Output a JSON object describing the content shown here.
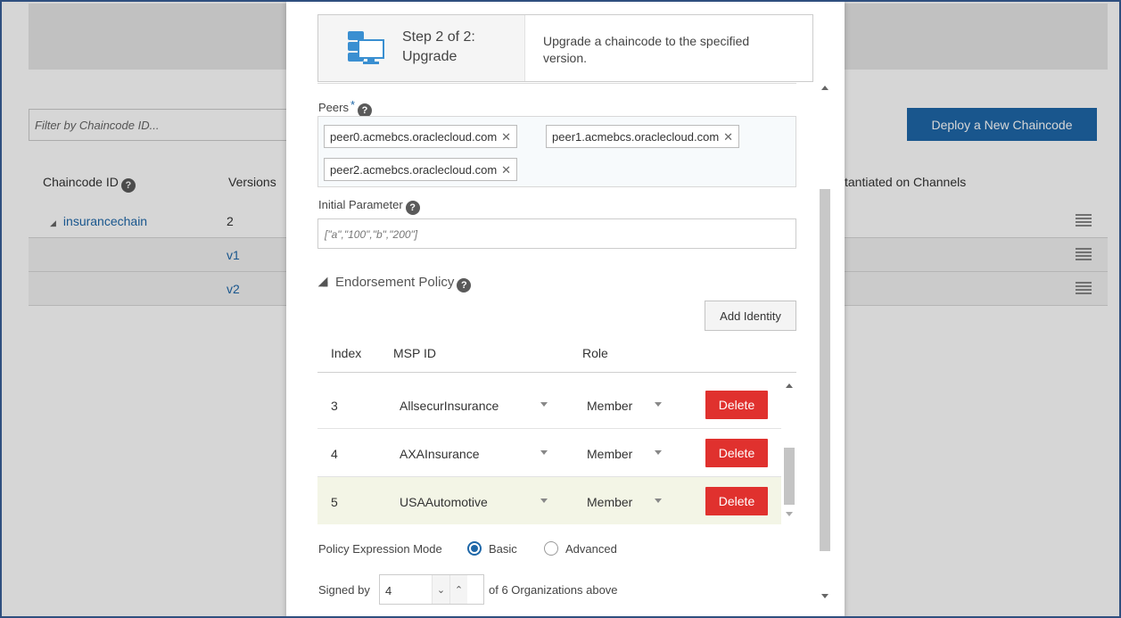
{
  "background": {
    "filter_placeholder": "Filter by Chaincode ID...",
    "deploy_button": "Deploy a New Chaincode",
    "columns": {
      "chaincode_id": "Chaincode ID",
      "versions": "Versions",
      "instantiated": "tantiated on Channels"
    },
    "rows": [
      {
        "chaincode": "insurancechain",
        "version": "2"
      },
      {
        "chaincode": "",
        "version": "v1"
      },
      {
        "chaincode": "",
        "version": "v2"
      }
    ],
    "accent": "#1e67a8"
  },
  "dialog": {
    "step_title": "Step 2 of 2:\nUpgrade",
    "step_desc": "Upgrade a chaincode to the specified version.",
    "peers_label": "Peers",
    "required_mark": "*",
    "help_mark": "?",
    "peers": [
      "peer0.acmebcs.oraclecloud.com",
      "peer1.acmebcs.oraclecloud.com",
      "peer2.acmebcs.oraclecloud.com"
    ],
    "chip_remove": "✕",
    "initial_param_label": "Initial Parameter",
    "initial_param_placeholder": "[\"a\",\"100\",\"b\",\"200\"]",
    "endorsement_label": "Endorsement Policy",
    "add_identity": "Add Identity",
    "table_headers": {
      "index": "Index",
      "msp": "MSP ID",
      "role": "Role"
    },
    "table_rows": [
      {
        "index": "3",
        "msp": "AllsecurInsurance",
        "role": "Member",
        "delete": "Delete"
      },
      {
        "index": "4",
        "msp": "AXAInsurance",
        "role": "Member",
        "delete": "Delete"
      },
      {
        "index": "5",
        "msp": "USAAutomotive",
        "role": "Member",
        "delete": "Delete"
      }
    ],
    "policy_mode_label": "Policy Expression Mode",
    "mode_basic": "Basic",
    "mode_advanced": "Advanced",
    "selected_mode": "Basic",
    "signed_by_label": "Signed by",
    "signed_by_value": "4",
    "signed_by_suffix": "of 6 Organizations above",
    "delete_color": "#e0312e"
  }
}
